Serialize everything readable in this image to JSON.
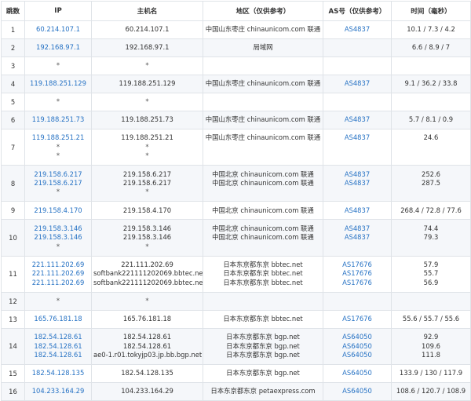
{
  "colors": {
    "link": "#2672c4",
    "border": "#dfe3e8",
    "zebra": "#f5f7fa",
    "text": "#333333"
  },
  "headers": {
    "hop": "跳数",
    "ip": "IP",
    "host": "主机名",
    "location": "地区（仅供参考）",
    "asn": "AS号（仅供参考）",
    "time": "时间（毫秒）"
  },
  "rows": [
    {
      "hop": "1",
      "ips": [
        "60.214.107.1"
      ],
      "hosts": [
        "60.214.107.1"
      ],
      "locs": [
        "中国山东枣庄 chinaunicom.com 联通"
      ],
      "asns": [
        "AS4837"
      ],
      "times": [
        "10.1 / 7.3 / 4.2"
      ]
    },
    {
      "hop": "2",
      "ips": [
        "192.168.97.1"
      ],
      "hosts": [
        "192.168.97.1"
      ],
      "locs": [
        "局域网"
      ],
      "asns": [
        ""
      ],
      "times": [
        "6.6 / 8.9 / 7"
      ]
    },
    {
      "hop": "3",
      "ips": [
        "*"
      ],
      "hosts": [
        "*"
      ],
      "locs": [
        ""
      ],
      "asns": [
        ""
      ],
      "times": [
        ""
      ]
    },
    {
      "hop": "4",
      "ips": [
        "119.188.251.129"
      ],
      "hosts": [
        "119.188.251.129"
      ],
      "locs": [
        "中国山东枣庄 chinaunicom.com 联通"
      ],
      "asns": [
        "AS4837"
      ],
      "times": [
        "9.1 / 36.2 / 33.8"
      ]
    },
    {
      "hop": "5",
      "ips": [
        "*"
      ],
      "hosts": [
        "*"
      ],
      "locs": [
        ""
      ],
      "asns": [
        ""
      ],
      "times": [
        ""
      ]
    },
    {
      "hop": "6",
      "ips": [
        "119.188.251.73"
      ],
      "hosts": [
        "119.188.251.73"
      ],
      "locs": [
        "中国山东枣庄 chinaunicom.com 联通"
      ],
      "asns": [
        "AS4837"
      ],
      "times": [
        "5.7 / 8.1 / 0.9"
      ]
    },
    {
      "hop": "7",
      "ips": [
        "119.188.251.21",
        "*",
        "*"
      ],
      "hosts": [
        "119.188.251.21",
        "*",
        "*"
      ],
      "locs": [
        "中国山东枣庄 chinaunicom.com 联通",
        "",
        ""
      ],
      "asns": [
        "AS4837",
        "",
        ""
      ],
      "times": [
        "24.6",
        "",
        ""
      ]
    },
    {
      "hop": "8",
      "ips": [
        "219.158.6.217",
        "219.158.6.217",
        "*"
      ],
      "hosts": [
        "219.158.6.217",
        "219.158.6.217",
        "*"
      ],
      "locs": [
        "中国北京 chinaunicom.com 联通",
        "中国北京 chinaunicom.com 联通",
        ""
      ],
      "asns": [
        "AS4837",
        "AS4837",
        ""
      ],
      "times": [
        "252.6",
        "287.5",
        ""
      ]
    },
    {
      "hop": "9",
      "ips": [
        "219.158.4.170"
      ],
      "hosts": [
        "219.158.4.170"
      ],
      "locs": [
        "中国北京 chinaunicom.com 联通"
      ],
      "asns": [
        "AS4837"
      ],
      "times": [
        "268.4 / 72.8 / 77.6"
      ]
    },
    {
      "hop": "10",
      "ips": [
        "219.158.3.146",
        "219.158.3.146",
        "*"
      ],
      "hosts": [
        "219.158.3.146",
        "219.158.3.146",
        "*"
      ],
      "locs": [
        "中国北京 chinaunicom.com 联通",
        "中国北京 chinaunicom.com 联通",
        ""
      ],
      "asns": [
        "AS4837",
        "AS4837",
        ""
      ],
      "times": [
        "74.4",
        "79.3",
        ""
      ]
    },
    {
      "hop": "11",
      "ips": [
        "221.111.202.69",
        "221.111.202.69",
        "221.111.202.69"
      ],
      "hosts": [
        "221.111.202.69",
        "softbank221111202069.bbtec.net",
        "softbank221111202069.bbtec.net"
      ],
      "locs": [
        "日本东京都东京 bbtec.net",
        "日本东京都东京 bbtec.net",
        "日本东京都东京 bbtec.net"
      ],
      "asns": [
        "AS17676",
        "AS17676",
        "AS17676"
      ],
      "times": [
        "57.9",
        "55.7",
        "56.9"
      ]
    },
    {
      "hop": "12",
      "ips": [
        "*"
      ],
      "hosts": [
        "*"
      ],
      "locs": [
        ""
      ],
      "asns": [
        ""
      ],
      "times": [
        ""
      ]
    },
    {
      "hop": "13",
      "ips": [
        "165.76.181.18"
      ],
      "hosts": [
        "165.76.181.18"
      ],
      "locs": [
        "日本东京都东京 bbtec.net"
      ],
      "asns": [
        "AS17676"
      ],
      "times": [
        "55.6 / 55.7 / 55.6"
      ]
    },
    {
      "hop": "14",
      "ips": [
        "182.54.128.61",
        "182.54.128.61",
        "182.54.128.61"
      ],
      "hosts": [
        "182.54.128.61",
        "182.54.128.61",
        "ae0-1.r01.tokyjp03.jp.bb.bgp.net"
      ],
      "locs": [
        "日本东京都东京 bgp.net",
        "日本东京都东京 bgp.net",
        "日本东京都东京 bgp.net"
      ],
      "asns": [
        "AS64050",
        "AS64050",
        "AS64050"
      ],
      "times": [
        "92.9",
        "109.6",
        "111.8"
      ]
    },
    {
      "hop": "15",
      "ips": [
        "182.54.128.135"
      ],
      "hosts": [
        "182.54.128.135"
      ],
      "locs": [
        "日本东京都东京 bgp.net"
      ],
      "asns": [
        "AS64050"
      ],
      "times": [
        "133.9 / 130 / 117.9"
      ]
    },
    {
      "hop": "16",
      "ips": [
        "104.233.164.29"
      ],
      "hosts": [
        "104.233.164.29"
      ],
      "locs": [
        "日本东京都东京 petaexpress.com"
      ],
      "asns": [
        "AS64050"
      ],
      "times": [
        "108.6 / 120.7 / 108.9"
      ]
    }
  ]
}
